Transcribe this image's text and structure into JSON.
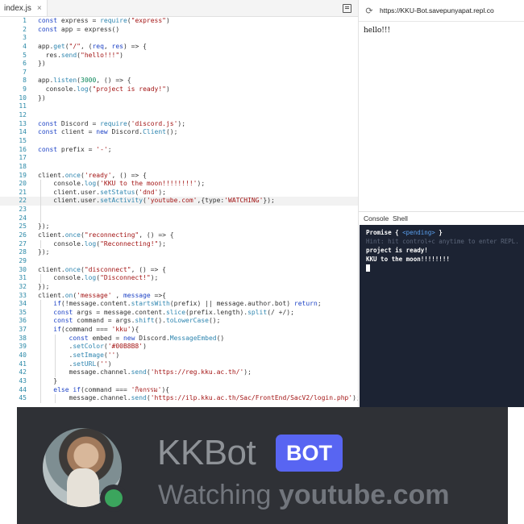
{
  "editor": {
    "tab_label": "index.js",
    "tab_close": "×",
    "lines": [
      {
        "n": "1",
        "html": "<span class='kw'>const</span> express = <span class='fn'>require</span>(<span class='str'>\"express\"</span>)"
      },
      {
        "n": "2",
        "html": "<span class='kw'>const</span> app = express()"
      },
      {
        "n": "3",
        "html": ""
      },
      {
        "n": "4",
        "html": "app.<span class='fn'>get</span>(<span class='str'>\"/\"</span>, (<span class='kw'>req</span>, <span class='kw'>res</span>) => {"
      },
      {
        "n": "5",
        "html": "  res.<span class='fn'>send</span>(<span class='str'>\"hello!!!\"</span>)"
      },
      {
        "n": "6",
        "html": "})"
      },
      {
        "n": "7",
        "html": ""
      },
      {
        "n": "8",
        "html": "app.<span class='fn'>listen</span>(<span class='num'>3000</span>, () => {"
      },
      {
        "n": "9",
        "html": "  console.<span class='fn'>log</span>(<span class='str'>\"project is ready!\"</span>)"
      },
      {
        "n": "10",
        "html": "})"
      },
      {
        "n": "11",
        "html": ""
      },
      {
        "n": "12",
        "html": ""
      },
      {
        "n": "13",
        "html": "<span class='kw'>const</span> Discord = <span class='fn'>require</span>(<span class='str'>'discord.js'</span>);"
      },
      {
        "n": "14",
        "html": "<span class='kw'>const</span> client = <span class='kw'>new</span> Discord.<span class='fn'>Client</span>();"
      },
      {
        "n": "15",
        "html": ""
      },
      {
        "n": "16",
        "html": "<span class='kw'>const</span> prefix = <span class='str'>'-'</span>;"
      },
      {
        "n": "17",
        "html": ""
      },
      {
        "n": "18",
        "html": ""
      },
      {
        "n": "19",
        "html": "client.<span class='fn'>once</span>(<span class='str'>'ready'</span>, () => {"
      },
      {
        "n": "20",
        "html": "    console.<span class='fn'>log</span>(<span class='str'>'KKU to the moon!!!!!!!!'</span>);",
        "g": 1
      },
      {
        "n": "21",
        "html": "    client.user.<span class='fn'>setStatus</span>(<span class='str'>'dnd'</span>);",
        "g": 1
      },
      {
        "n": "22",
        "html": "    client.user.<span class='fn'>setActivity</span>(<span class='str'>'youtube.com'</span>,{type:<span class='str'>'WATCHING'</span>});",
        "g": 1,
        "active": true
      },
      {
        "n": "23",
        "html": "",
        "g": 1
      },
      {
        "n": "24",
        "html": "",
        "g": 1
      },
      {
        "n": "25",
        "html": "});"
      },
      {
        "n": "26",
        "html": "client.<span class='fn'>once</span>(<span class='str'>\"reconnecting\"</span>, () => {"
      },
      {
        "n": "27",
        "html": "    console.<span class='fn'>log</span>(<span class='str'>\"Reconnecting!\"</span>);",
        "g": 1
      },
      {
        "n": "28",
        "html": "});"
      },
      {
        "n": "29",
        "html": ""
      },
      {
        "n": "30",
        "html": "client.<span class='fn'>once</span>(<span class='str'>\"disconnect\"</span>, () => {"
      },
      {
        "n": "31",
        "html": "    console.<span class='fn'>log</span>(<span class='str'>\"Disconnect!\"</span>);",
        "g": 1
      },
      {
        "n": "32",
        "html": "});"
      },
      {
        "n": "33",
        "html": "client.<span class='fn'>on</span>(<span class='str'>'message'</span> , <span class='kw'>message</span> =>{"
      },
      {
        "n": "34",
        "html": "    <span class='kw'>if</span>(!message.content.<span class='fn'>startsWith</span>(prefix) || message.author.bot) <span class='kw'>return</span>;",
        "g": 1
      },
      {
        "n": "35",
        "html": "    <span class='kw'>const</span> args = message.content.<span class='fn'>slice</span>(prefix.length).<span class='fn'>split</span>(/ +/);",
        "g": 1
      },
      {
        "n": "36",
        "html": "    <span class='kw'>const</span> command = args.<span class='fn'>shift</span>().<span class='fn'>toLowerCase</span>();",
        "g": 1
      },
      {
        "n": "37",
        "html": "    <span class='kw'>if</span>(command === <span class='str'>'kku'</span>){",
        "g": 1
      },
      {
        "n": "38",
        "html": "        <span class='kw'>const</span> embed = <span class='kw'>new</span> Discord.<span class='fn'>MessageEmbed</span>()",
        "g": 2
      },
      {
        "n": "39",
        "html": "        .<span class='fn'>setColor</span>(<span class='str'>'#00B8B8'</span>)",
        "g": 2
      },
      {
        "n": "40",
        "html": "        .<span class='fn'>setImage</span>(<span class='str'>''</span>)",
        "g": 2
      },
      {
        "n": "41",
        "html": "        .<span class='fn'>setURL</span>(<span class='str'>''</span>)",
        "g": 2
      },
      {
        "n": "42",
        "html": "        message.channel.<span class='fn'>send</span>(<span class='str'>'https://reg.kku.ac.th/'</span>);",
        "g": 2
      },
      {
        "n": "43",
        "html": "    }",
        "g": 1
      },
      {
        "n": "44",
        "html": "    <span class='kw'>else if</span>(command === <span class='str'>'กิจกรรม'</span>){",
        "g": 1
      },
      {
        "n": "45",
        "html": "        message.channel.<span class='fn'>send</span>(<span class='str'>'https://ilp.kku.ac.th/Sac/FrontEnd/SacV2/login.php'</span>);",
        "g": 2
      }
    ]
  },
  "webview": {
    "url": "https://KKU-Bot.savepunyapat.repl.co",
    "page_text": "hello!!!"
  },
  "console": {
    "tabs": [
      "Console",
      "Shell"
    ],
    "promise_prefix": "Promise { ",
    "promise_pending": "<pending>",
    "promise_suffix": " }",
    "hint": "Hint: hit control+c anytime to enter REPL.",
    "line_ready": "project is ready!",
    "line_moon": "KKU to the moon!!!!!!!!"
  },
  "discord": {
    "bot_name": "KKBot",
    "badge": "BOT",
    "activity_prefix": "Watching ",
    "activity_name": "youtube.com",
    "status_color": "#3ba55d",
    "badge_color": "#5865f2"
  }
}
